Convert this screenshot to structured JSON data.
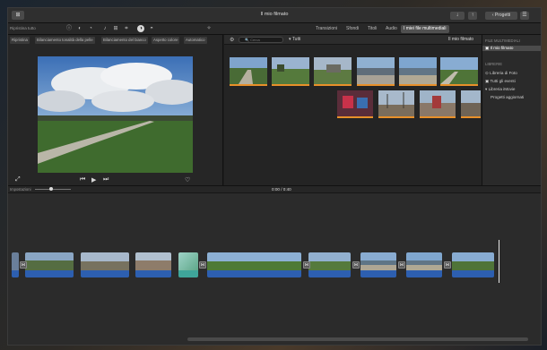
{
  "window": {
    "title": "Il mio filmato",
    "share_label": "Progetti",
    "left_button_label": "⊞"
  },
  "toolbar": {
    "restore_label": "Ripristina tutto",
    "tabs": [
      {
        "label": "I miei file multimediali",
        "selected": true
      },
      {
        "label": "Audio",
        "selected": false
      },
      {
        "label": "Titoli",
        "selected": false
      },
      {
        "label": "Sfondi",
        "selected": false
      },
      {
        "label": "Transizioni",
        "selected": false
      }
    ]
  },
  "viewer": {
    "adjustments": [
      "Automatico",
      "Aspetto colore",
      "Bilanciamento del bianco",
      "Bilanciamento tonalità della pelle",
      "Ripristina"
    ]
  },
  "browser": {
    "title": "Il mio filmato",
    "filter": "Tutti",
    "search_placeholder": "Cerca"
  },
  "library": {
    "header": "FILE MULTIMEDIALI",
    "items": [
      {
        "label": "Il mio filmato",
        "selected": true
      },
      {
        "label": "LIBRERIE",
        "header": true
      },
      {
        "label": "Libreria di Foto",
        "selected": false
      },
      {
        "label": "Tutti gli eventi",
        "selected": false
      },
      {
        "label": "Libreria iMovie",
        "selected": false
      },
      {
        "label": "Progetti aggiornati",
        "selected": false
      }
    ]
  },
  "timeline": {
    "time": "0:00",
    "duration": "0:40",
    "zoom_label": "Impostazioni"
  },
  "colors": {
    "accent": "#e8902a",
    "audio_track": "#2d5fb0",
    "selected_tab": "#505050"
  }
}
